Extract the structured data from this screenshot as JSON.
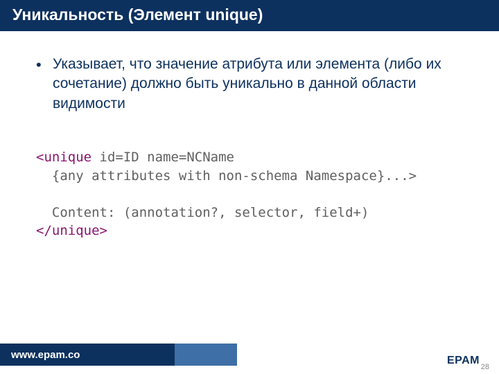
{
  "title": "Уникальность (Элемент unique)",
  "bullet": "Указывает, что значение атрибута или элемента (либо их сочетание) должно быть уникально в данной области видимости",
  "code": {
    "open1": "<unique",
    "open2": " id=ID name=NCName",
    "line2": "  {any attributes with non-schema Namespace}...>",
    "blank": "",
    "line3": "  Content: (annotation?, selector, field+)",
    "close": "</unique>"
  },
  "footer": {
    "url": "www.epam.co",
    "brand": "EPAM",
    "page": "28"
  }
}
